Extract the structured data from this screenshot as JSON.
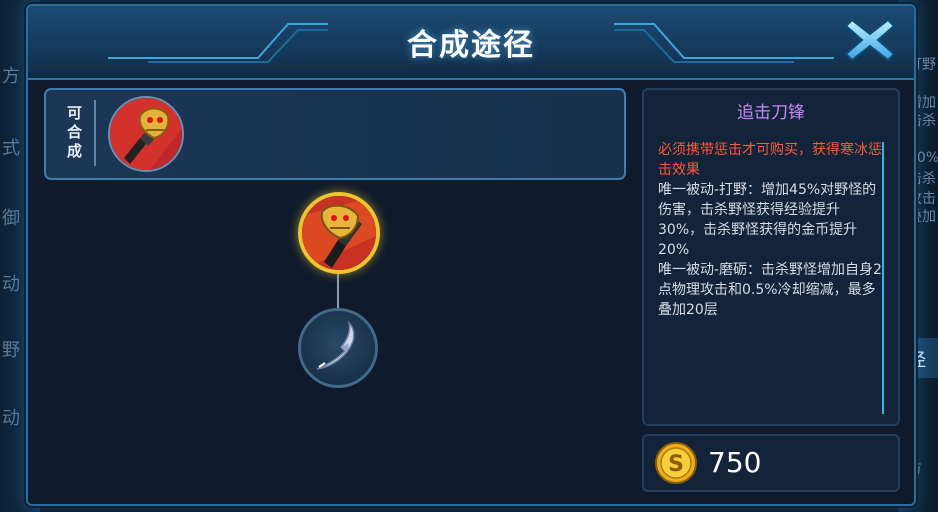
{
  "dialog": {
    "title": "合成途径",
    "close_icon": "close-x-icon"
  },
  "craftable": {
    "label": "可合成",
    "item_icon": "golden-mask-blade-icon"
  },
  "recipe_tree": {
    "root_icon": "golden-mask-blade-icon",
    "child_icon": "curved-scythe-blade-icon"
  },
  "item": {
    "name": "追击刀锋",
    "requirement": "必须携带惩击才可购买，获得寒冰惩击效果",
    "passive_1": "唯一被动-打野：增加45%对野怪的伤害，击杀野怪获得经验提升30%，击杀野怪获得的金币提升20%",
    "passive_2": "唯一被动-磨砺：击杀野怪增加自身2点物理攻击和0.5%冷却缩减，最多叠加20层",
    "price": "750",
    "currency_icon": "gold-coin-icon"
  },
  "colors": {
    "item_name": "#c08bf0",
    "requirement": "#ff5a3a",
    "accent": "#2db7e8",
    "selected_ring": "#f0c431"
  }
}
